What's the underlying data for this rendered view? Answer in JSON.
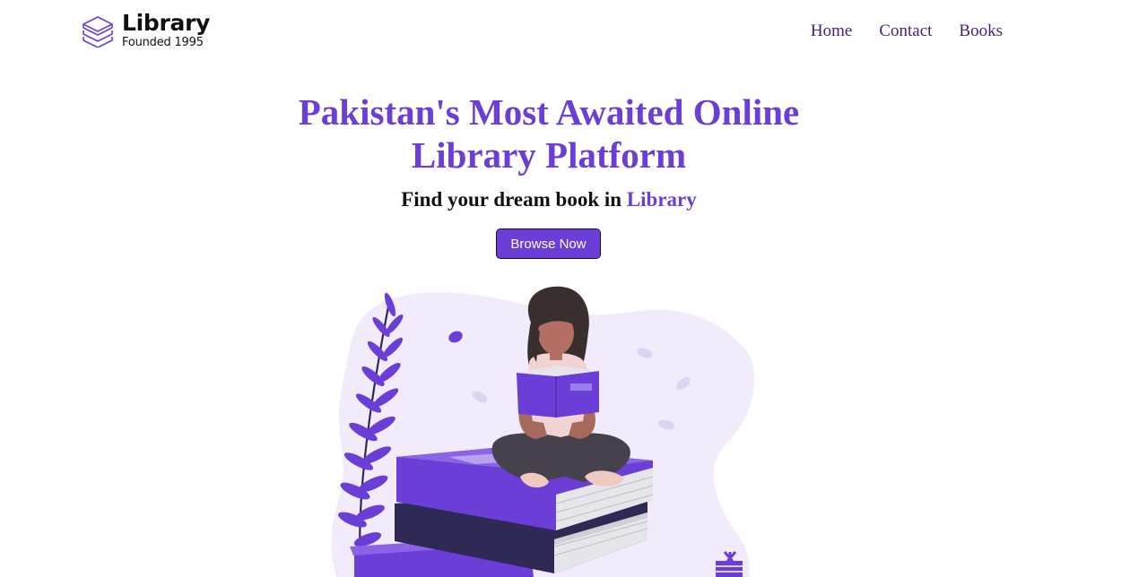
{
  "header": {
    "logo": {
      "name": "Library",
      "subtitle": "Founded 1995",
      "icon": "stacked-books-icon"
    },
    "nav": [
      {
        "label": "Home"
      },
      {
        "label": "Contact"
      },
      {
        "label": "Books"
      }
    ]
  },
  "hero": {
    "title": "Pakistan's Most Awaited Online Library Platform",
    "subtitle_prefix": "Find your dream book in",
    "subtitle_accent": "Library",
    "button_label": "Browse Now"
  },
  "illustration": {
    "subject": "woman-reading-on-book-stack"
  },
  "colors": {
    "accent": "#6c3ed8",
    "nav_link": "#4b1b83",
    "text_dark": "#111111",
    "blob_bg": "#f1ebfb"
  }
}
